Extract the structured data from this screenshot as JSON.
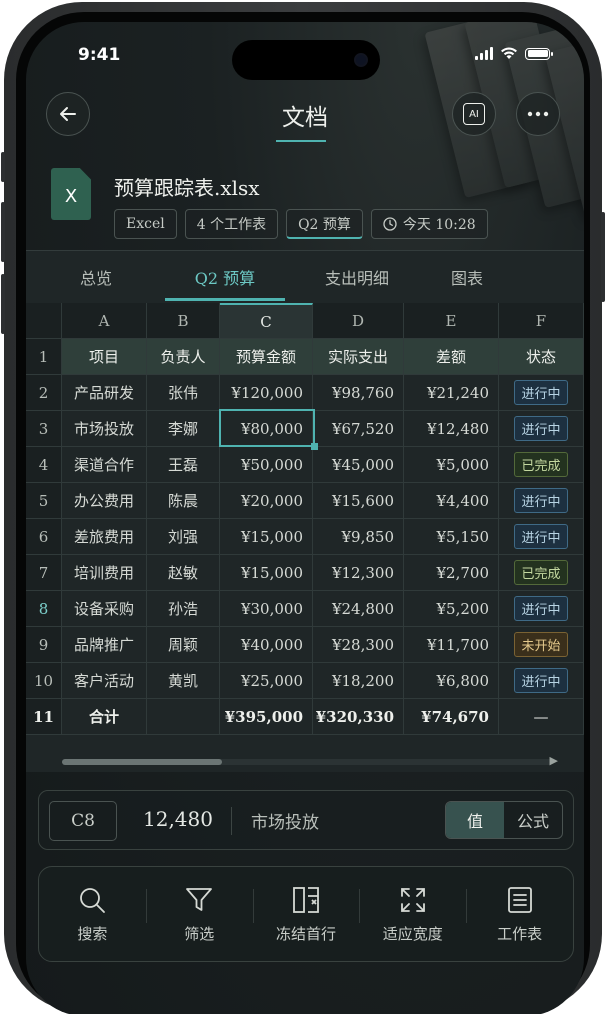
{
  "status_bar": {
    "time": "9:41"
  },
  "nav": {
    "title": "文档",
    "back_icon": "arrow-left-icon",
    "ai_label": "AI",
    "more_icon": "more-dots-icon"
  },
  "file": {
    "name": "预算跟踪表.xlsx",
    "icon_letter": "X",
    "chips": {
      "type": "Excel",
      "sheets": "4 个工作表",
      "active_sheet": "Q2 预算",
      "modified": "今天 10:28"
    }
  },
  "tabs": [
    {
      "label": "总览"
    },
    {
      "label": "Q2 预算"
    },
    {
      "label": "支出明细"
    },
    {
      "label": "图表"
    }
  ],
  "spreadsheet": {
    "column_letters": [
      "A",
      "B",
      "C",
      "D",
      "E",
      "F"
    ],
    "selected_column": "C",
    "header_row": {
      "no": "1",
      "cells": [
        "项目",
        "负责人",
        "预算金额",
        "实际支出",
        "差额",
        "状态"
      ]
    },
    "rows": [
      {
        "no": "2",
        "item": "产品研发",
        "owner": "张伟",
        "budget": "¥120,000",
        "actual": "¥98,760",
        "diff": "¥21,240",
        "status": "进行中",
        "status_type": "prog"
      },
      {
        "no": "3",
        "item": "市场投放",
        "owner": "李娜",
        "budget": "¥80,000",
        "actual": "¥67,520",
        "diff": "¥12,480",
        "status": "进行中",
        "status_type": "prog"
      },
      {
        "no": "4",
        "item": "渠道合作",
        "owner": "王磊",
        "budget": "¥50,000",
        "actual": "¥45,000",
        "diff": "¥5,000",
        "status": "已完成",
        "status_type": "done"
      },
      {
        "no": "5",
        "item": "办公费用",
        "owner": "陈晨",
        "budget": "¥20,000",
        "actual": "¥15,600",
        "diff": "¥4,400",
        "status": "进行中",
        "status_type": "prog"
      },
      {
        "no": "6",
        "item": "差旅费用",
        "owner": "刘强",
        "budget": "¥15,000",
        "actual": "¥9,850",
        "diff": "¥5,150",
        "status": "进行中",
        "status_type": "prog"
      },
      {
        "no": "7",
        "item": "培训费用",
        "owner": "赵敏",
        "budget": "¥15,000",
        "actual": "¥12,300",
        "diff": "¥2,700",
        "status": "已完成",
        "status_type": "done"
      },
      {
        "no": "8",
        "item": "设备采购",
        "owner": "孙浩",
        "budget": "¥30,000",
        "actual": "¥24,800",
        "diff": "¥5,200",
        "status": "进行中",
        "status_type": "prog"
      },
      {
        "no": "9",
        "item": "品牌推广",
        "owner": "周颖",
        "budget": "¥40,000",
        "actual": "¥28,300",
        "diff": "¥11,700",
        "status": "未开始",
        "status_type": "todo"
      },
      {
        "no": "10",
        "item": "客户活动",
        "owner": "黄凯",
        "budget": "¥25,000",
        "actual": "¥18,200",
        "diff": "¥6,800",
        "status": "进行中",
        "status_type": "prog"
      }
    ],
    "total_row": {
      "no": "11",
      "label": "合计",
      "owner": "",
      "budget": "¥395,000",
      "actual": "¥320,330",
      "diff": "¥74,670",
      "status": "—"
    }
  },
  "formula_bar": {
    "cell_ref": "C8",
    "value": "12,480",
    "row_label": "市场投放",
    "mode_value": "值",
    "mode_formula": "公式",
    "active_mode": "值"
  },
  "toolbar": [
    {
      "label": "搜索",
      "icon": "search-icon"
    },
    {
      "label": "筛选",
      "icon": "filter-icon"
    },
    {
      "label": "冻结首行",
      "icon": "freeze-row-icon"
    },
    {
      "label": "适应宽度",
      "icon": "fit-width-icon"
    },
    {
      "label": "工作表",
      "icon": "worksheet-icon"
    }
  ],
  "colors": {
    "accent": "#4fb3b0",
    "header_row_bg": "#2f3f3a",
    "status_progress": "#b8d4e4",
    "status_done": "#c4d8a0",
    "status_todo": "#e4c98c"
  }
}
